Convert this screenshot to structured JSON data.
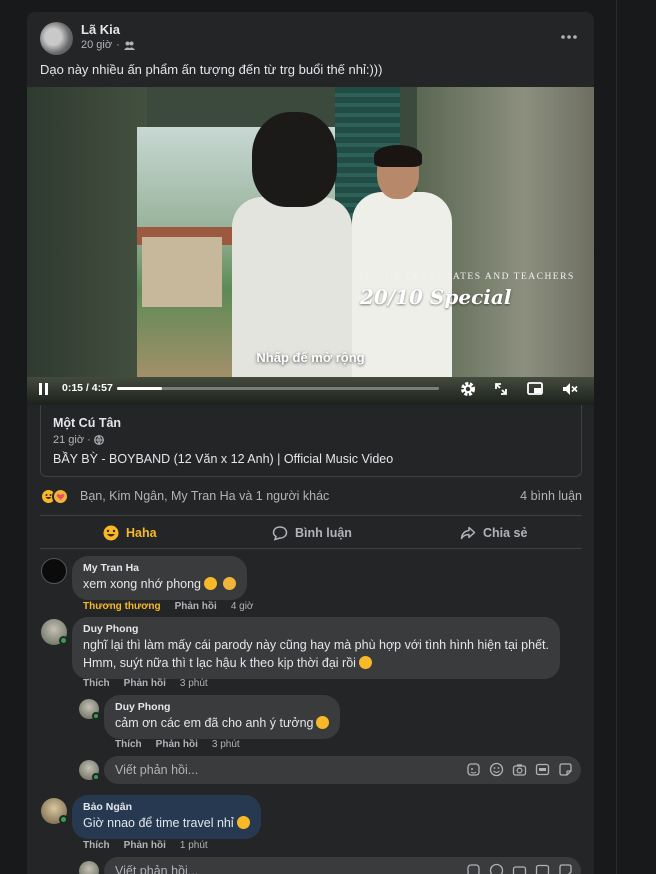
{
  "post": {
    "author": "Lã Kia",
    "time": "20 giờ",
    "audience_icon": "friends-icon",
    "caption": "Dạo này nhiều ấn phẩm ấn tượng đến từ trg buổi thế nhỉ:)))",
    "video": {
      "subtitle": "TO OUR CLASSMATES AND TEACHERS",
      "title": "20/10 Special",
      "expand_hint": "Nhấp để mở rộng",
      "time": "0:15 / 4:57",
      "progress": 0.14
    },
    "link": {
      "page_name": "Một Cú Tân",
      "time": "21 giờ",
      "title": "BẦY BỲ - BOYBAND (12 Văn x 12 Anh) | Official Music Video"
    },
    "reactions": {
      "summary": "Bạn, Kim Ngân, My Tran Ha và 1 người khác",
      "comments_count": "4 bình luận"
    },
    "actions": {
      "haha": "Haha",
      "comment": "Bình luận",
      "share": "Chia sẻ"
    }
  },
  "comments": [
    {
      "author": "My Tran Ha",
      "text": "xem xong nhớ phong",
      "reaction": "Thương thương",
      "reply": "Phản hồi",
      "time": "4 giờ"
    },
    {
      "author": "Duy Phong",
      "text_line1": "nghĩ lại thì làm mấy cái parody này cũng hay mà phù hợp với tình hình hiện tại phết.",
      "text_line2": "Hmm, suýt nữa thì t lạc hậu k theo kịp thời đại rồi",
      "like": "Thích",
      "reply": "Phản hồi",
      "time": "3 phút"
    },
    {
      "author": "Duy Phong",
      "text": "cảm ơn các em đã cho anh ý tưởng",
      "like": "Thích",
      "reply": "Phản hồi",
      "time": "3 phút"
    },
    {
      "author": "Bảo Ngân",
      "text": "Giờ nnao để time travel nhỉ",
      "like": "Thích",
      "reply": "Phản hồi",
      "time": "1 phút"
    }
  ],
  "reply_placeholder": "Viết phản hồi...",
  "colors": {
    "background": "#18191a",
    "card": "#242526",
    "bubble": "#3a3b3c",
    "highlight_bubble": "#263951",
    "haha_accent": "#f7b928",
    "online": "#31a24c"
  }
}
